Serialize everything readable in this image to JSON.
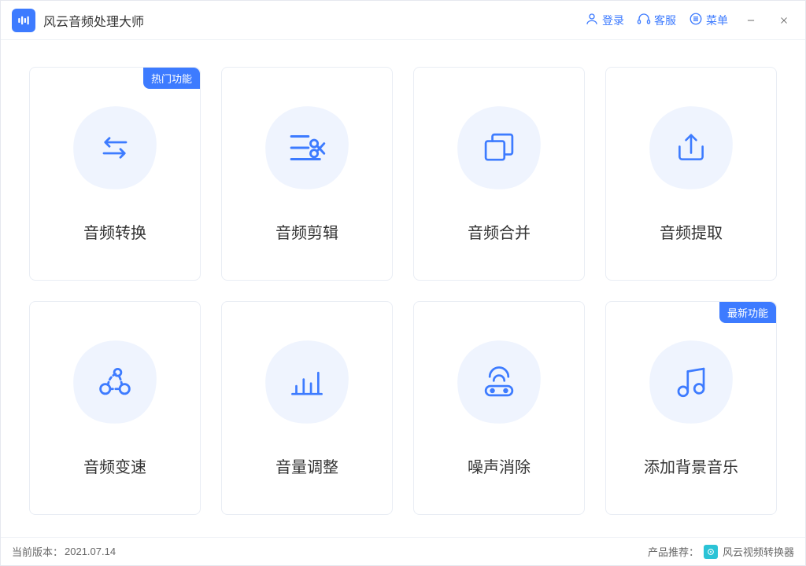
{
  "app": {
    "title": "风云音频处理大师"
  },
  "titlebar": {
    "login": "登录",
    "service": "客服",
    "menu": "菜单"
  },
  "cards": [
    {
      "label": "音频转换",
      "badge": "热门功能"
    },
    {
      "label": "音频剪辑",
      "badge": null
    },
    {
      "label": "音频合并",
      "badge": null
    },
    {
      "label": "音频提取",
      "badge": null
    },
    {
      "label": "音频变速",
      "badge": null
    },
    {
      "label": "音量调整",
      "badge": null
    },
    {
      "label": "噪声消除",
      "badge": null
    },
    {
      "label": "添加背景音乐",
      "badge": "最新功能"
    }
  ],
  "footer": {
    "version_label": "当前版本：",
    "version": "2021.07.14",
    "recommend_label": "产品推荐：",
    "recommend_product": "风云视频转换器"
  }
}
